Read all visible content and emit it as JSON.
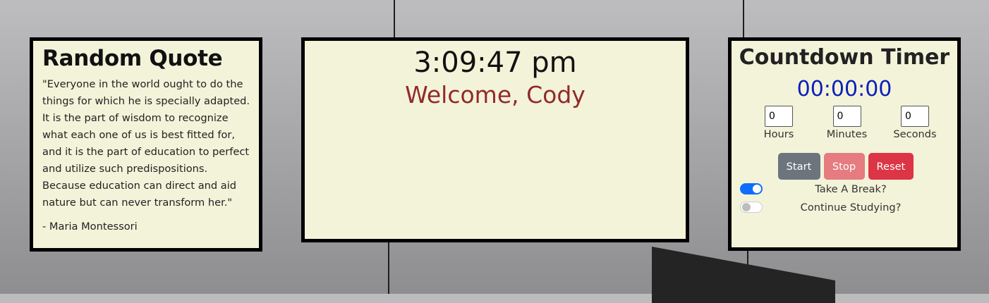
{
  "quote": {
    "title": "Random Quote",
    "text": "\"Everyone in the world ought to do the things for which he is specially adapted. It is the part of wisdom to recognize what each one of us is best fitted for, and it is the part of education to perfect and utilize such predispositions. Because education can direct and aid nature but can never transform her.\"",
    "author": "- Maria Montessori"
  },
  "clock": {
    "time": "3:09:47 pm",
    "welcome": "Welcome, Cody"
  },
  "timer": {
    "title": "Countdown Timer",
    "display": "00:00:00",
    "fields": [
      {
        "label": "Hours",
        "value": "0"
      },
      {
        "label": "Minutes",
        "value": "0"
      },
      {
        "label": "Seconds",
        "value": "0"
      }
    ],
    "buttons": {
      "start": "Start",
      "stop": "Stop",
      "reset": "Reset"
    },
    "toggles": [
      {
        "label": "Take A Break?",
        "on": true
      },
      {
        "label": "Continue Studying?",
        "on": false
      }
    ]
  },
  "colors": {
    "panel_bg": "#f3f3da",
    "welcome": "#922a2a",
    "timer_display": "#0b1fb8",
    "start": "#6c757d",
    "stop": "#e67b80",
    "reset": "#dc3545",
    "toggle_on": "#0d6efd"
  }
}
